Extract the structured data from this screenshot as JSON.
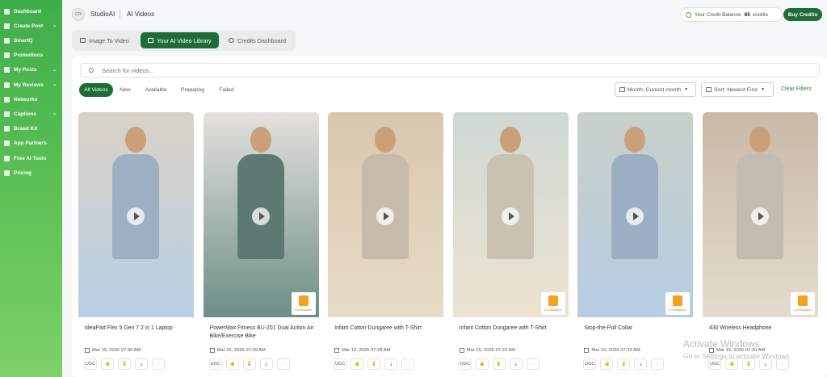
{
  "sidebar": {
    "items": [
      {
        "label": "Dashboard",
        "chevron": false,
        "icon": "home-icon"
      },
      {
        "label": "Create Post",
        "chevron": true,
        "icon": "plus-icon"
      },
      {
        "label": "SmartQ",
        "chevron": false,
        "icon": "smart-icon"
      },
      {
        "label": "Promotions",
        "chevron": false,
        "icon": "megaphone-icon"
      },
      {
        "label": "My Posts",
        "chevron": true,
        "icon": "posts-icon"
      },
      {
        "label": "My Reviews",
        "chevron": true,
        "icon": "star-icon"
      },
      {
        "label": "Networks",
        "chevron": false,
        "icon": "network-icon"
      },
      {
        "label": "Captions",
        "chevron": true,
        "icon": "caption-icon"
      },
      {
        "label": "Brand Kit",
        "chevron": false,
        "icon": "shield-icon"
      },
      {
        "label": "App Partners",
        "chevron": false,
        "icon": "partners-icon"
      },
      {
        "label": "Free AI Tools",
        "chevron": false,
        "icon": "tools-icon"
      },
      {
        "label": "Pricing",
        "chevron": false,
        "icon": "price-icon"
      }
    ]
  },
  "header": {
    "avatar": "CR",
    "workspace": "StudioAI",
    "page": "AI Videos",
    "credit_label": "Your Credit Balance",
    "credit_value": "65",
    "credit_unit": "credits",
    "buy_label": "Buy Credits"
  },
  "tabs": [
    {
      "label": "Image To Video",
      "active": false,
      "icon": "image-icon"
    },
    {
      "label": "Your AI Video Library",
      "active": true,
      "icon": "library-icon"
    },
    {
      "label": "Credits Dashboard",
      "active": false,
      "icon": "credits-icon"
    }
  ],
  "search": {
    "placeholder": "Search for videos..."
  },
  "filters": {
    "chips": [
      {
        "label": "All Videos",
        "active": true
      },
      {
        "label": "New",
        "active": false
      },
      {
        "label": "Available",
        "active": false
      },
      {
        "label": "Preparing",
        "active": false
      },
      {
        "label": "Failed",
        "active": false
      }
    ],
    "month": "Month: Current month",
    "sort": "Sort: Newest First",
    "clear": "Clear Filters"
  },
  "videos": [
    {
      "title": "IdeaPad Flex 5 Gen 7 2 in 1 Laptop",
      "date": "Mar 15, 2026 07:30 AM",
      "badge": false,
      "bg": "#d9d2c6",
      "accent": "#b9cfe4"
    },
    {
      "title": "PowerMax Fitness BU-201 Dual Action Air Bike/Exercise Bike",
      "date": "Mar 15, 2026 07:29 AM",
      "badge": true,
      "bg": "#e4e1dc",
      "accent": "#6d8f86"
    },
    {
      "title": "Infant Cotton Dungaree with T-Shirt",
      "date": "Mar 15, 2026 07:28 AM",
      "badge": false,
      "bg": "#d8c7ad",
      "accent": "#e8dcc6"
    },
    {
      "title": "Infant Cotton Dungaree with T-Shirt",
      "date": "Mar 15, 2026 07:23 AM",
      "badge": true,
      "bg": "#cfd8d4",
      "accent": "#ece3d1"
    },
    {
      "title": "Stop-the-Pull Collar",
      "date": "Mar 15, 2026 07:22 AM",
      "badge": true,
      "bg": "#c8d0c9",
      "accent": "#b7cde3"
    },
    {
      "title": "430 Wireless Headphone",
      "date": "Mar 15, 2026 07:20 AM",
      "badge": true,
      "bg": "#c9b8a6",
      "accent": "#e4dccf"
    }
  ],
  "card_actions": {
    "ugc": "UGC"
  },
  "badge_text": "E-COMMERCE",
  "watermark": {
    "line1": "Activate Windows",
    "line2": "Go to Settings to activate Windows."
  }
}
